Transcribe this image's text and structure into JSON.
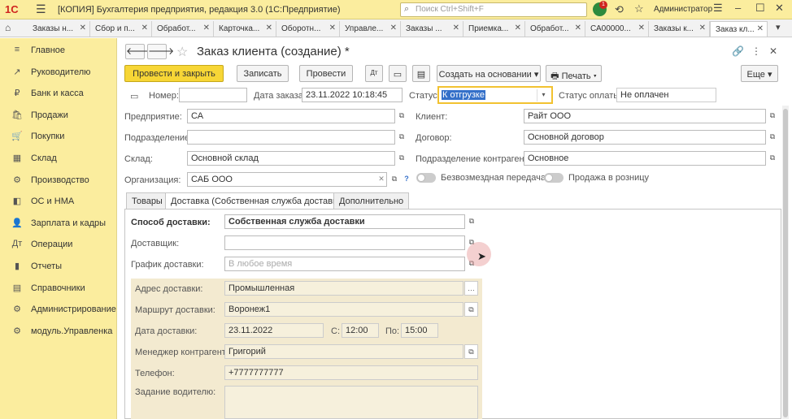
{
  "titlebar": {
    "logo": "1С",
    "title": "[КОПИЯ] Бухгалтерия предприятия, редакция 3.0  (1С:Предприятие)",
    "search_placeholder": "Поиск Ctrl+Shift+F",
    "notification_count": "1",
    "user": "Администратор"
  },
  "open_tabs": [
    {
      "label": "Заказы н..."
    },
    {
      "label": "Сбор и п..."
    },
    {
      "label": "Обработ..."
    },
    {
      "label": "Карточка..."
    },
    {
      "label": "Оборотн..."
    },
    {
      "label": "Управле..."
    },
    {
      "label": "Заказы ..."
    },
    {
      "label": "Приемка..."
    },
    {
      "label": "Обработ..."
    },
    {
      "label": "СА00000..."
    },
    {
      "label": "Заказы к..."
    },
    {
      "label": "Заказ кл..."
    }
  ],
  "sidebar": {
    "items": [
      {
        "label": "Главное",
        "icon": "≡"
      },
      {
        "label": "Руководителю",
        "icon": "↗"
      },
      {
        "label": "Банк и касса",
        "icon": "₽"
      },
      {
        "label": "Продажи",
        "icon": "🛍"
      },
      {
        "label": "Покупки",
        "icon": "🛒"
      },
      {
        "label": "Склад",
        "icon": "▦"
      },
      {
        "label": "Производство",
        "icon": "⚙"
      },
      {
        "label": "ОС и НМА",
        "icon": "◧"
      },
      {
        "label": "Зарплата и кадры",
        "icon": "👤"
      },
      {
        "label": "Операции",
        "icon": "Дт"
      },
      {
        "label": "Отчеты",
        "icon": "▮"
      },
      {
        "label": "Справочники",
        "icon": "▤"
      },
      {
        "label": "Администрирование",
        "icon": "⚙"
      },
      {
        "label": "модуль.Управленка",
        "icon": "⚙"
      }
    ]
  },
  "form": {
    "title": "Заказ клиента (создание) *",
    "buttons": {
      "post_close": "Провести и закрыть",
      "save": "Записать",
      "post": "Провести",
      "create_based": "Создать на основании",
      "print": "Печать",
      "more": "Еще"
    },
    "fields": {
      "number_label": "Номер:",
      "number_value": "",
      "date_label": "Дата заказа:",
      "date_value": "23.11.2022 10:18:45",
      "status_label": "Статус:",
      "status_value": "К отгрузке",
      "pay_status_label": "Статус оплаты:",
      "pay_status_value": "Не оплачен",
      "enterprise_label": "Предприятие:",
      "enterprise_value": "СА",
      "client_label": "Клиент:",
      "client_value": "Райт ООО",
      "division_label": "Подразделение:",
      "division_value": "",
      "contract_label": "Договор:",
      "contract_value": "Основной договор",
      "warehouse_label": "Склад:",
      "warehouse_value": "Основной склад",
      "counterparty_division_label": "Подразделение контрагента:",
      "counterparty_division_value": "Основное",
      "organization_label": "Организация:",
      "organization_value": "САБ ООО",
      "free_transfer_label": "Безвозмездная передача",
      "retail_label": "Продажа в розницу",
      "help": "?"
    },
    "tabs": [
      {
        "label": "Товары"
      },
      {
        "label": "Доставка (Собственная служба доставки)"
      },
      {
        "label": "Дополнительно"
      }
    ],
    "delivery": {
      "method_label": "Способ доставки:",
      "method_value": "Собственная служба доставки",
      "carrier_label": "Доставщик:",
      "carrier_value": "",
      "schedule_label": "График доставки:",
      "schedule_placeholder": "В любое время",
      "address_label": "Адрес доставки:",
      "address_value": "Промышленная",
      "route_label": "Маршрут доставки:",
      "route_value": "Воронеж1",
      "date_label": "Дата доставки:",
      "date_value": "23.11.2022",
      "from_label": "С:",
      "from_value": "12:00",
      "to_label": "По:",
      "to_value": "15:00",
      "manager_label": "Менеджер контрагента:",
      "manager_value": "Григорий",
      "phone_label": "Телефон:",
      "phone_value": "+7777777777",
      "driver_task_label": "Задание водителю:",
      "driver_task_value": ""
    }
  }
}
